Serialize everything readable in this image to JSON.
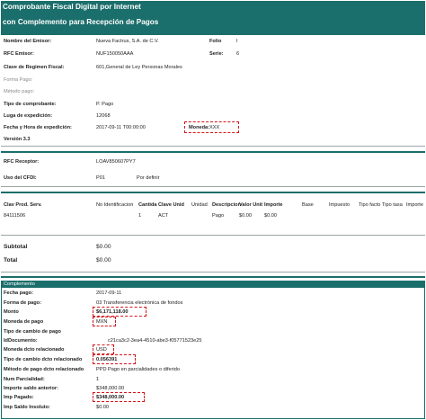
{
  "header": {
    "line1": "Comprobante Fiscal Digital por Internet",
    "line2": "con Complemento para Recepción de Pagos"
  },
  "emisor": {
    "nombre_label": "Nombre del Emisor:",
    "nombre_value": "Nueva Factrus, S.A. de C.V.",
    "rfc_label": "RFC Emisor:",
    "rfc_value": "NUF150050AAA",
    "regimen_label": "Clave de Regimen Fiscal:",
    "regimen_value": "601,General de Ley Personas Morales",
    "forma_pago_label": "Forma Pago:",
    "metodo_pago_label": "Método pago:",
    "tipo_label": "Tipo de comprobante:",
    "tipo_value": "P. Pago",
    "lugar_label": "Luga de expedición:",
    "lugar_value": "12068",
    "fecha_label": "Fecha y Hora de expedición:",
    "fecha_value": "2017-09-11 T00:00:00",
    "version": "Versión 3.3",
    "folio_label": "Folio",
    "folio_value": "I",
    "serie_label": "Serie:",
    "serie_value": "6",
    "moneda_label": "Moneda:",
    "moneda_value": "XXX"
  },
  "receptor": {
    "rfc_label": "RFC Receptor:",
    "rfc_value": "LOAV850607PY7",
    "uso_label": "Uso del CFDI:",
    "uso_value": "P01",
    "uso_desc": "Por definir"
  },
  "items_table": {
    "headers": [
      "Clav Prod. Serv.",
      "No Identificacion",
      "Cantida",
      "Clave Unid",
      "Unidad",
      "Descripcion",
      "Valor Unit",
      "Importe",
      "Base",
      "Impuesto",
      "Tipo facto",
      "Tipo tasa",
      "Importe"
    ],
    "row": [
      "84111506",
      "",
      "1",
      "ACT",
      "",
      "Pago",
      "$0.00",
      "$0.00",
      "",
      "",
      "",
      "",
      ""
    ]
  },
  "totals": {
    "subtotal_label": "Subtotal",
    "subtotal_value": "$0.00",
    "total_label": "Total",
    "total_value": "$0.00"
  },
  "complemento": {
    "title": "Complemento",
    "rows": [
      {
        "label": "Fecha pago:",
        "value": "2017-09-11"
      },
      {
        "label": "Forma de pago:",
        "value": "03 Transferencia electrónica de fondos"
      },
      {
        "label": "Monto",
        "value": "$6,171,118.00"
      },
      {
        "label": "Moneda de pago",
        "value": "MXN"
      },
      {
        "label": "Tipo de cambio de pago",
        "value": ""
      },
      {
        "label": "IdDocumento:",
        "value": "c21ca3c2-3ea4-4510-abe3-f05771523e25"
      },
      {
        "label": "Moneda dcto relacionado",
        "value": "USD"
      },
      {
        "label": "Tipo de cambio dcto relacionado",
        "value": "0.056391"
      },
      {
        "label": "Método de pago dcto relacionado",
        "value": "PPD Pago en parcialidades o diferido"
      },
      {
        "label": "Num Parcialidad:",
        "value": "1"
      },
      {
        "label": "Importe saldo anterior:",
        "value": "$348,000.00"
      },
      {
        "label": "Imp Pagado:",
        "value": "$348,000.00"
      },
      {
        "label": "Imp Saldo Insoluto:",
        "value": "$0.00"
      }
    ]
  }
}
